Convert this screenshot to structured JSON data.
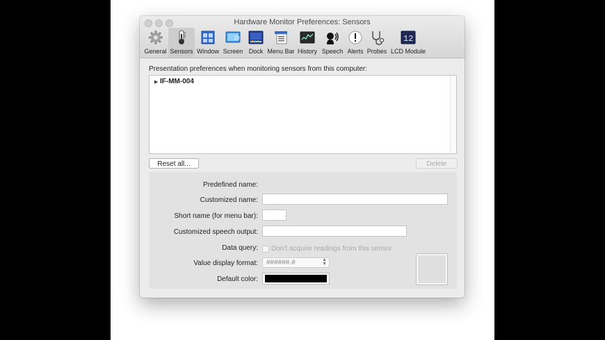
{
  "window": {
    "title": "Hardware Monitor Preferences: Sensors"
  },
  "toolbar": {
    "items": [
      {
        "label": "General",
        "icon": "gear-icon"
      },
      {
        "label": "Sensors",
        "icon": "thermometer-icon",
        "selected": true
      },
      {
        "label": "Window",
        "icon": "window-icon"
      },
      {
        "label": "Screen",
        "icon": "screen-icon"
      },
      {
        "label": "Dock",
        "icon": "dock-icon"
      },
      {
        "label": "Menu Bar",
        "icon": "menu-bar-icon"
      },
      {
        "label": "History",
        "icon": "history-icon"
      },
      {
        "label": "Speech",
        "icon": "speech-icon"
      },
      {
        "label": "Alerts",
        "icon": "alert-icon"
      },
      {
        "label": "Probes",
        "icon": "stethoscope-icon"
      },
      {
        "label": "LCD Module",
        "icon": "lcd-icon"
      }
    ],
    "screen_icon_text": "23",
    "lcd_icon_text": "12"
  },
  "sensors": {
    "description": "Presentation preferences when monitoring sensors from this computer:",
    "list": [
      {
        "name": "IF-MM-004",
        "expanded": false
      }
    ],
    "reset_button": "Reset all...",
    "delete_button": "Delete"
  },
  "form": {
    "predefined_name_label": "Predefined name:",
    "predefined_name_value": "",
    "customized_name_label": "Customized name:",
    "customized_name_value": "",
    "short_name_label": "Short name (for menu bar):",
    "short_name_value": "",
    "speech_output_label": "Customized speech output:",
    "speech_output_value": "",
    "data_query_label": "Data query:",
    "data_query_checkbox": "Don't acquire readings from this sensor",
    "data_query_checked": false,
    "value_format_label": "Value display format:",
    "value_format_value": "######.#",
    "default_color_label": "Default color:",
    "default_color": "#000000"
  }
}
